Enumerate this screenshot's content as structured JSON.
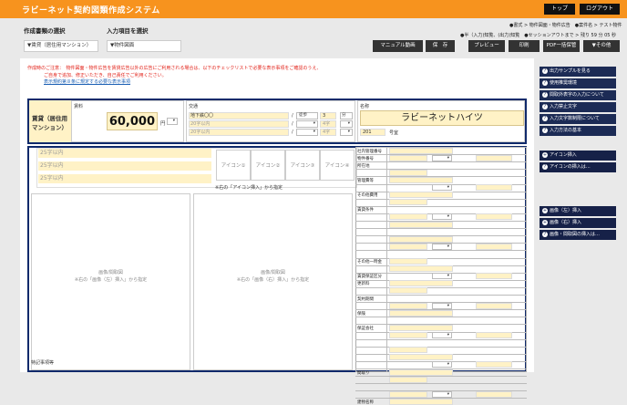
{
  "header": {
    "title": "ラビーネット契約図類作成システム",
    "top_btn": "トップ",
    "logout_btn": "ログアウト"
  },
  "selectors": {
    "doc_type_label": "作成書類の選択",
    "doc_type_value": "▼賃貸（居住用マンション）",
    "item_label": "入力項目を選択",
    "item_value": "▼物件図面"
  },
  "breadcrumb": {
    "line1": "●書式 > 物件図面・物件広告　●案件名 > テスト物件",
    "line2": "●半（入力)知覧、(出力)知覧　●セッションアウトまで > 残り 59 分 05 秒"
  },
  "actions": {
    "manual": "マニュアル動画",
    "save": "保　存",
    "preview": "プレビュー",
    "print": "印刷",
    "pdf": "PDF一括保管",
    "other": "▼その他"
  },
  "warning": {
    "line1": "作成時のご注意：　物件図面・物件広告を賃貸広告以外の広告にご利用される場合は、以下のチェックリストで必要な表示事項をご確認のうえ、",
    "line2": "ご自身で追加、修正いただき、自己責任でご利用ください。",
    "link": "表示規約第８条に規定する必要な表示事項"
  },
  "form": {
    "rent_label": "賃貸（居住用マンション）",
    "rent_sub": "賃料",
    "rent_value": "60,000",
    "rent_unit": "円",
    "traffic_label": "交通",
    "station": "地下鉄〇〇",
    "station_sub1": "20字以内",
    "station_sub2": "20字以内",
    "walk": "徒歩",
    "minutes": "3",
    "min_unit": "分",
    "char4a": "4字",
    "char4b": "4字",
    "name_label": "名称",
    "name_value": "ラビーネットハイツ",
    "room_no": "201",
    "room_unit": "号室",
    "text_ph": "25字以内",
    "icons": [
      "アイコン①",
      "アイコン②",
      "アイコン③",
      "アイコン④"
    ],
    "icon_note": "※右の「アイコン挿入」から指定",
    "img_left": "画像/間取図\n※右の「画像（左）挿入」から指定",
    "img_right": "画像/間取図\n※右の「画像（右）挿入」から指定",
    "notes_label": "特記事項等"
  },
  "right": {
    "rows": [
      "社内管理番号",
      "物件番号",
      "所在地",
      "",
      "管理費等",
      "",
      "その他費用",
      "",
      "賃貸条件",
      "",
      "",
      "",
      "",
      "",
      "",
      "その他一時金",
      "",
      "賃貸保証区分",
      "更新料",
      "",
      "契約期間",
      "",
      "保険",
      "",
      "保証会社",
      "",
      "",
      "",
      "",
      "",
      "間取り",
      "",
      "",
      "",
      "建物名称"
    ],
    "labels": {
      "ka": "契約期間",
      "ke": "賃貸中",
      "ko": "管理形態"
    },
    "small_ph": "12字以内"
  },
  "sidebar": {
    "group1": [
      "出力サンプルを見る",
      "使用推奨環境",
      "間取外表字の入力について",
      "入力禁止文字",
      "入力文字数制限について",
      "入力方法の基本"
    ],
    "group2": [
      "アイコン挿入",
      "アイコンの挿入は…"
    ],
    "group3": [
      "画像（左）挿入",
      "画像（右）挿入",
      "画像・間取図の挿入は…"
    ]
  }
}
